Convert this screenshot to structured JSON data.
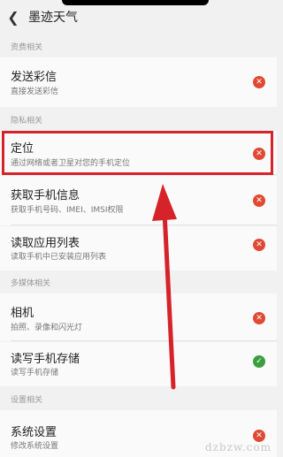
{
  "header": {
    "title": "墨迹天气",
    "back_icon": "chevron-left-icon"
  },
  "sections": [
    {
      "label": "资费相关"
    },
    {
      "label": "隐私相关"
    },
    {
      "label": "多媒体相关"
    },
    {
      "label": "设置相关"
    }
  ],
  "permissions": [
    {
      "label": "发送彩信",
      "desc": "直接发送彩信",
      "status": "denied",
      "icon": "x-circle-icon"
    },
    {
      "label": "定位",
      "desc": "通过网络或者卫星对您的手机定位",
      "status": "denied",
      "icon": "x-circle-icon"
    },
    {
      "label": "获取手机信息",
      "desc": "获取手机号码、IMEI、IMSI权限",
      "status": "denied",
      "icon": "x-circle-icon"
    },
    {
      "label": "读取应用列表",
      "desc": "读取手机中已安装应用列表",
      "status": "denied",
      "icon": "x-circle-icon"
    },
    {
      "label": "相机",
      "desc": "拍照、录像和闪光灯",
      "status": "denied",
      "icon": "x-circle-icon"
    },
    {
      "label": "读写手机存储",
      "desc": "读写手机存储",
      "status": "allowed",
      "icon": "check-circle-icon"
    },
    {
      "label": "系统设置",
      "desc": "修改系统设置",
      "status": "denied",
      "icon": "x-circle-icon"
    }
  ],
  "colors": {
    "denied": "#e04a33",
    "allowed": "#3aa03f",
    "highlight": "#d6232a"
  },
  "watermark": "dzbzw.com"
}
